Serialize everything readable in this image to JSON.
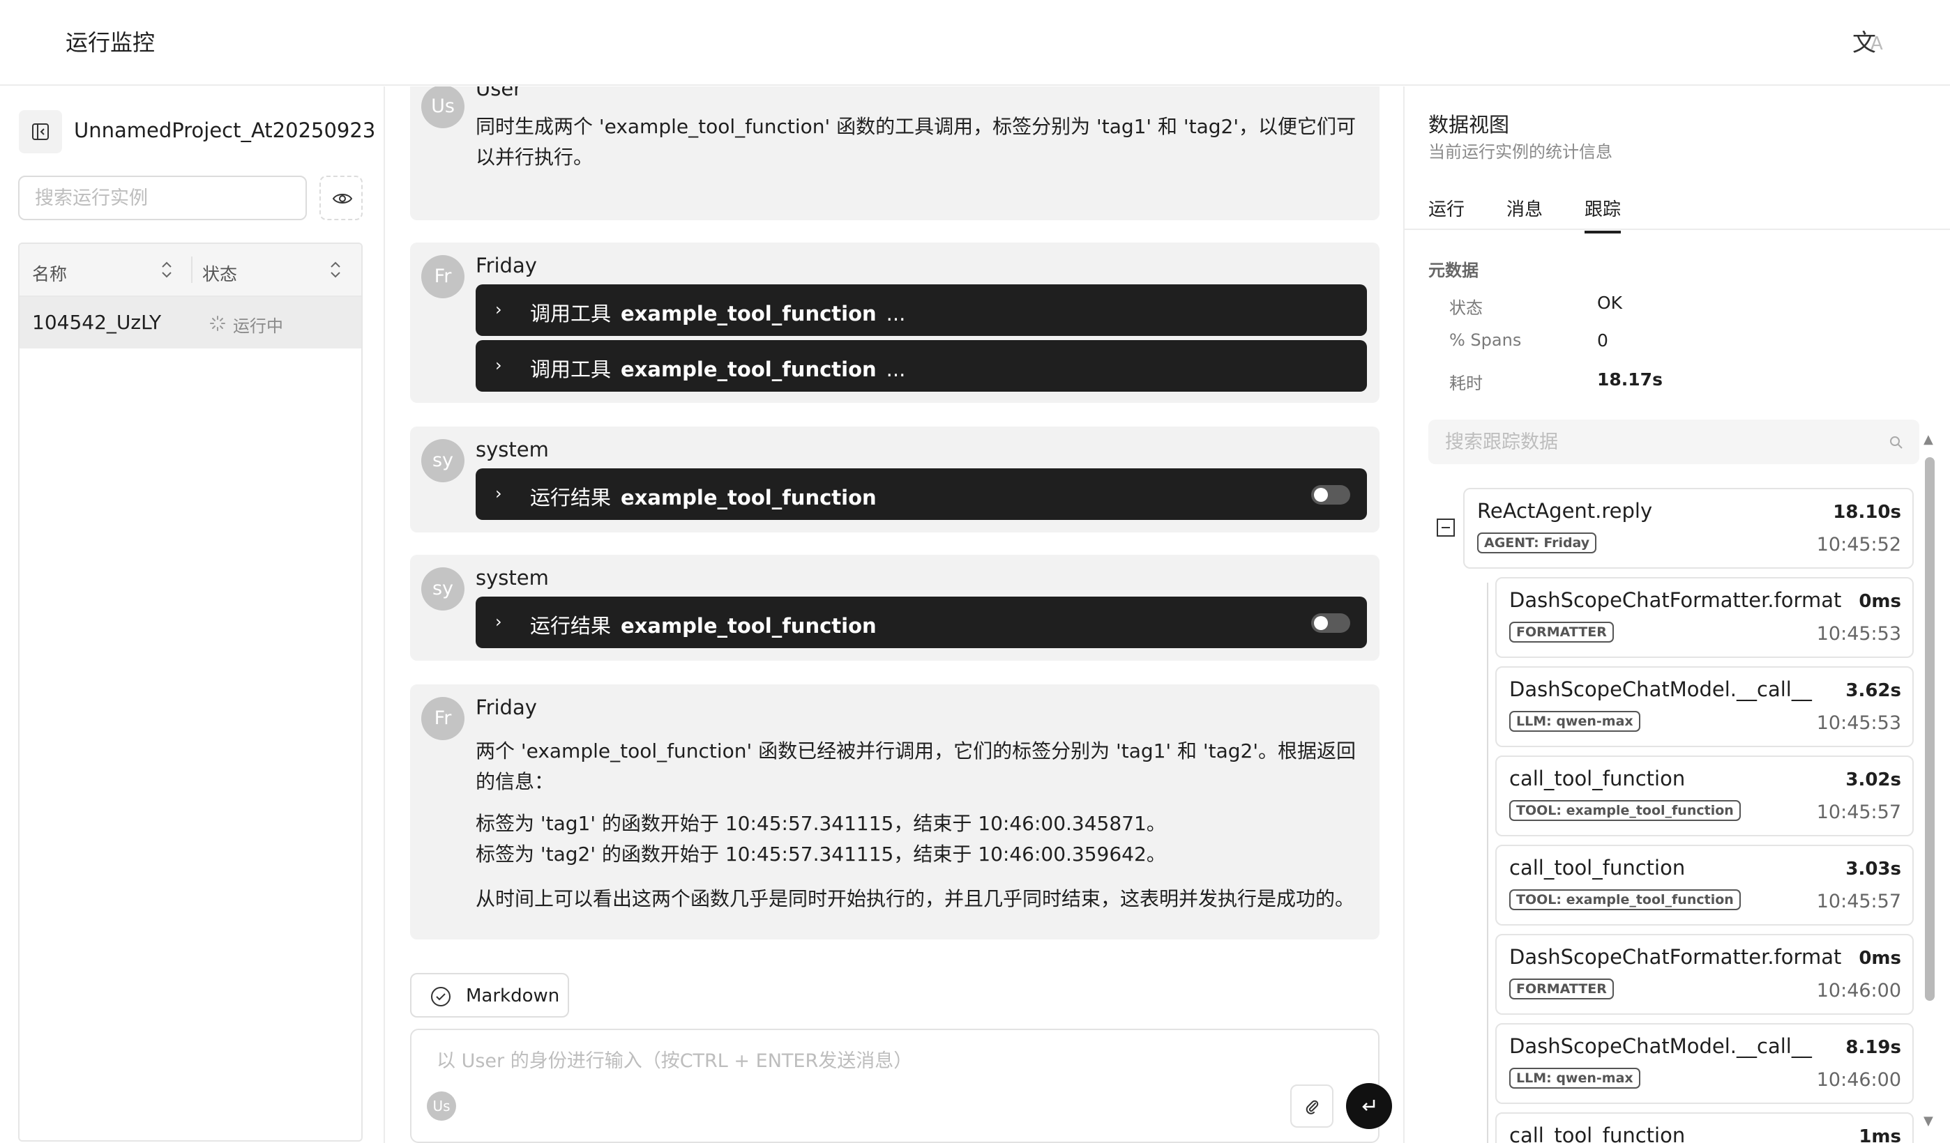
{
  "header": {
    "title": "运行监控",
    "lang_glyph": "文",
    "lang_glyph_sub": "A"
  },
  "left": {
    "project_name": "UnnamedProject_At20250923",
    "search_placeholder": "搜索运行实例",
    "table": {
      "col_name": "名称",
      "col_status": "状态",
      "rows": [
        {
          "name": "104542_UzLY",
          "status": "运行中"
        }
      ]
    }
  },
  "chat": {
    "messages": [
      {
        "avatar": "Us",
        "sender": "User",
        "text": "同时生成两个 'example_tool_function' 函数的工具调用，标签分别为 'tag1' 和 'tag2'，以便它们可以并行执行。"
      },
      {
        "avatar": "Fr",
        "sender": "Friday",
        "tool_calls": [
          {
            "prefix": "调用工具",
            "name": "example_tool_function",
            "suffix": "..."
          },
          {
            "prefix": "调用工具",
            "name": "example_tool_function",
            "suffix": "..."
          }
        ]
      },
      {
        "avatar": "sy",
        "sender": "system",
        "result": {
          "prefix": "运行结果",
          "name": "example_tool_function"
        }
      },
      {
        "avatar": "sy",
        "sender": "system",
        "result": {
          "prefix": "运行结果",
          "name": "example_tool_function"
        }
      },
      {
        "avatar": "Fr",
        "sender": "Friday",
        "paragraphs": [
          "两个 'example_tool_function' 函数已经被并行调用，它们的标签分别为 'tag1' 和 'tag2'。根据返回的信息：",
          "标签为 'tag1' 的函数开始于 10:45:57.341115，结束于 10:46:00.345871。",
          "标签为 'tag2' 的函数开始于 10:45:57.341115，结束于 10:46:00.359642。",
          "从时间上可以看出这两个函数几乎是同时开始执行的，并且几乎同时结束，这表明并发执行是成功的。"
        ]
      }
    ],
    "markdown_label": "Markdown",
    "input_placeholder": "以 User 的身份进行输入（按CTRL + ENTER发送消息）",
    "input_avatar": "Us"
  },
  "right": {
    "title": "数据视图",
    "subtitle": "当前运行实例的统计信息",
    "tabs": [
      "运行",
      "消息",
      "跟踪"
    ],
    "active_tab": "跟踪",
    "meta_title": "元数据",
    "meta": [
      {
        "key": "状态",
        "value": "OK"
      },
      {
        "key": "% Spans",
        "value": "0"
      },
      {
        "key": "耗时",
        "value": "18.17s"
      }
    ],
    "trace_search_placeholder": "搜索跟踪数据",
    "root_span": {
      "name": "ReActAgent.reply",
      "duration": "18.10s",
      "tag": "AGENT: Friday",
      "time": "10:45:52"
    },
    "child_spans": [
      {
        "name": "DashScopeChatFormatter.format",
        "duration": "0ms",
        "tag": "FORMATTER",
        "time": "10:45:53"
      },
      {
        "name": "DashScopeChatModel.__call__",
        "duration": "3.62s",
        "tag": "LLM: qwen-max",
        "time": "10:45:53"
      },
      {
        "name": "call_tool_function",
        "duration": "3.02s",
        "tag": "TOOL: example_tool_function",
        "time": "10:45:57"
      },
      {
        "name": "call_tool_function",
        "duration": "3.03s",
        "tag": "TOOL: example_tool_function",
        "time": "10:45:57"
      },
      {
        "name": "DashScopeChatFormatter.format",
        "duration": "0ms",
        "tag": "FORMATTER",
        "time": "10:46:00"
      },
      {
        "name": "DashScopeChatModel.__call__",
        "duration": "8.19s",
        "tag": "LLM: qwen-max",
        "time": "10:46:00"
      },
      {
        "name": "call_tool_function",
        "duration": "1ms",
        "tag": "",
        "time": ""
      }
    ]
  }
}
